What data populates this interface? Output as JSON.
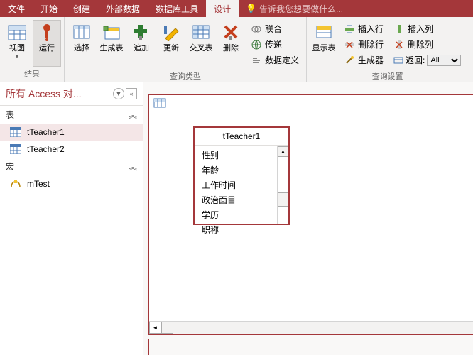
{
  "tabs": {
    "file": "文件",
    "home": "开始",
    "create": "创建",
    "external": "外部数据",
    "dbtools": "数据库工具",
    "design": "设计",
    "tellme": "告诉我您想要做什么..."
  },
  "ribbon": {
    "results": {
      "label": "结果",
      "view": "视图",
      "run": "运行",
      "select": "选择"
    },
    "qtype": {
      "label": "查询类型",
      "maketable": "生成表",
      "append": "追加",
      "update": "更新",
      "crosstab": "交叉表",
      "delete": "删除",
      "union": "联合",
      "passthrough": "传递",
      "datadef": "数据定义"
    },
    "setup": {
      "label": "查询设置",
      "showtable": "显示表",
      "insertrow": "插入行",
      "deleterow": "删除行",
      "builder": "生成器",
      "insertcol": "插入列",
      "deletecol": "删除列",
      "return": "返回:",
      "returnval": "All"
    }
  },
  "nav": {
    "title": "所有 Access 对...",
    "section_tables": "表",
    "t1": "tTeacher1",
    "t2": "tTeacher2",
    "section_macros": "宏",
    "m1": "mTest"
  },
  "table": {
    "title": "tTeacher1",
    "fields": [
      "性别",
      "年龄",
      "工作时间",
      "政治面目",
      "学历",
      "职称"
    ]
  }
}
